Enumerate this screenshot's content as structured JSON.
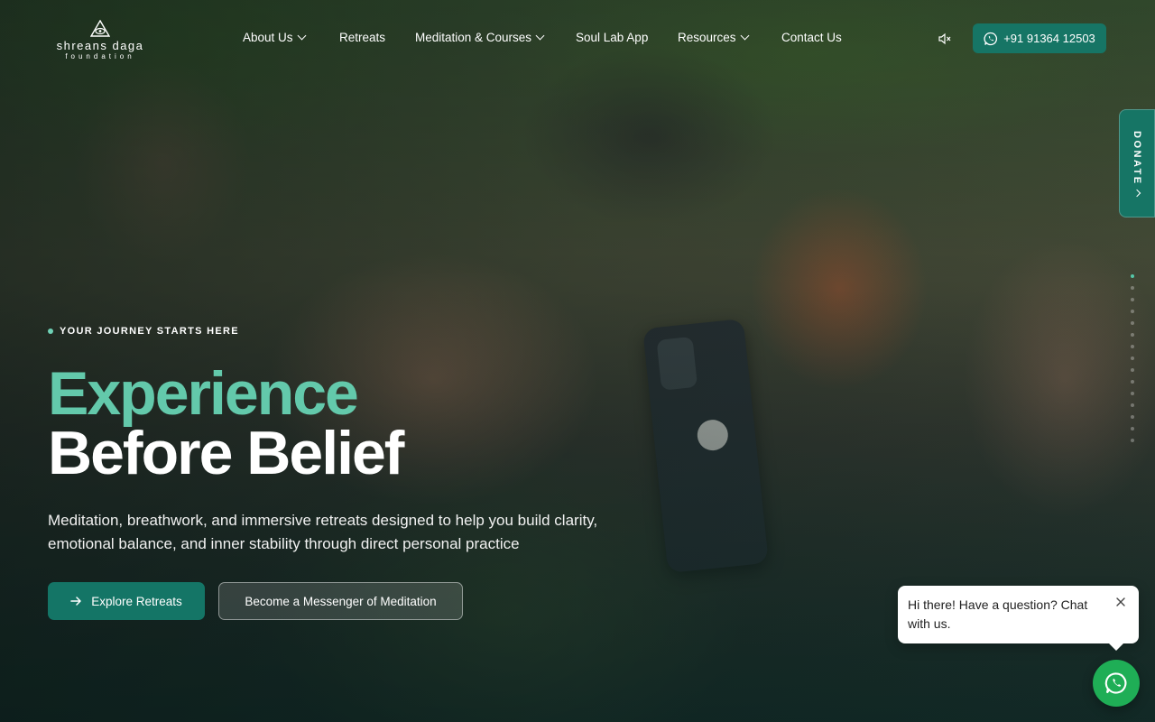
{
  "brand": {
    "name": "shreans daga",
    "sub": "foundation"
  },
  "nav": {
    "items": [
      {
        "label": "About Us",
        "has_dropdown": true
      },
      {
        "label": "Retreats",
        "has_dropdown": false
      },
      {
        "label": "Meditation & Courses",
        "has_dropdown": true
      },
      {
        "label": "Soul Lab App",
        "has_dropdown": false
      },
      {
        "label": "Resources",
        "has_dropdown": true
      },
      {
        "label": "Contact Us",
        "has_dropdown": false
      }
    ],
    "mute_icon": "speaker-muted-icon",
    "phone_label": "+91 91364 12503",
    "phone_icon": "whatsapp-icon"
  },
  "donate": {
    "label": "DONATE"
  },
  "hero": {
    "eyebrow": "YOUR JOURNEY STARTS HERE",
    "title_line_1": "Experience",
    "title_line_2": "Before Belief",
    "subtitle": "Meditation, breathwork, and immersive retreats designed to help you build clarity, emotional balance, and inner stability through direct personal practice",
    "primary_button": "Explore Retreats",
    "secondary_button": "Become a Messenger of Meditation"
  },
  "chat": {
    "message": "Hi there! Have a question? Chat with us."
  },
  "colors": {
    "accent_teal": "#167565",
    "title_teal": "#63c9ab",
    "whatsapp_green": "#1fae56"
  }
}
